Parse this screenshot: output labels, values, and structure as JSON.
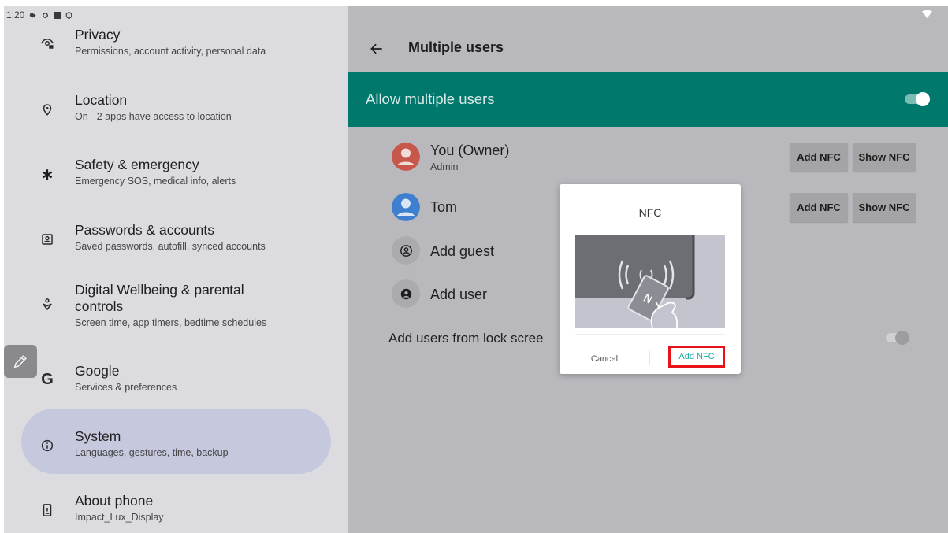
{
  "status_bar": {
    "time": "1:20"
  },
  "settings": {
    "items": [
      {
        "title": "Privacy",
        "subtitle": "Permissions, account activity, personal data",
        "icon": "privacy-icon"
      },
      {
        "title": "Location",
        "subtitle": "On - 2 apps have access to location",
        "icon": "location-pin-icon"
      },
      {
        "title": "Safety & emergency",
        "subtitle": "Emergency SOS, medical info, alerts",
        "icon": "asterisk-icon"
      },
      {
        "title": "Passwords & accounts",
        "subtitle": "Saved passwords, autofill, synced accounts",
        "icon": "account-box-icon"
      },
      {
        "title": "Digital Wellbeing & parental",
        "title_line2": "controls",
        "subtitle": "Screen time, app timers, bedtime schedules",
        "icon": "wellbeing-icon"
      },
      {
        "title": "Google",
        "subtitle": "Services & preferences",
        "icon": "google-g-icon"
      },
      {
        "title": "System",
        "subtitle": "Languages, gestures, time, backup",
        "icon": "info-circle-icon",
        "selected": true
      },
      {
        "title": "About phone",
        "subtitle": "Impact_Lux_Display",
        "icon": "phone-icon"
      }
    ]
  },
  "multiple_users": {
    "title": "Multiple users",
    "allow_label": "Allow multiple users",
    "allow_enabled": true,
    "users": [
      {
        "name": "You (Owner)",
        "role": "Admin",
        "avatar_color": "#c8574b",
        "add_btn": "Add NFC",
        "show_btn": "Show NFC"
      },
      {
        "name": "Tom",
        "role": "",
        "avatar_color": "#3f7fd0",
        "add_btn": "Add NFC",
        "show_btn": "Show NFC"
      }
    ],
    "add_guest": "Add guest",
    "add_user": "Add user",
    "lock_screen_label": "Add users from lock scree",
    "lock_screen_enabled": false
  },
  "dialog": {
    "title": "NFC",
    "cancel": "Cancel",
    "confirm": "Add NFC"
  },
  "colors": {
    "accent_teal": "#00786c",
    "highlight_red": "#e8131a",
    "confirm_text": "#15a99a"
  }
}
